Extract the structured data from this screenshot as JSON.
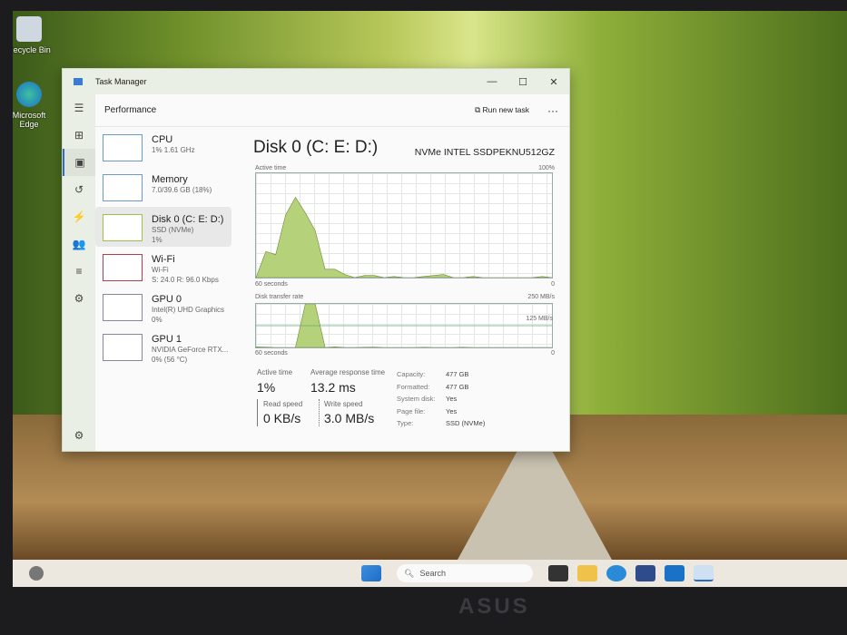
{
  "desktop": {
    "icons": [
      {
        "label": "Recycle Bin"
      },
      {
        "label": "Microsoft Edge"
      }
    ]
  },
  "window": {
    "title": "Task Manager",
    "minimize": "—",
    "maximize": "☐",
    "close": "✕"
  },
  "header": {
    "title": "Performance",
    "run_new_task": "Run new task",
    "more": "···"
  },
  "rail": [
    "hamburger-icon",
    "processes-icon",
    "performance-icon",
    "app-history-icon",
    "startup-icon",
    "users-icon",
    "details-icon",
    "services-icon",
    "settings-icon"
  ],
  "list": [
    {
      "name": "CPU",
      "sub1": "1% 1.61 GHz",
      "sub2": ""
    },
    {
      "name": "Memory",
      "sub1": "7.0/39.6 GB (18%)",
      "sub2": ""
    },
    {
      "name": "Disk 0 (C: E: D:)",
      "sub1": "SSD (NVMe)",
      "sub2": "1%"
    },
    {
      "name": "Wi-Fi",
      "sub1": "Wi-Fi",
      "sub2": "S: 24.0 R: 96.0 Kbps"
    },
    {
      "name": "GPU 0",
      "sub1": "Intel(R) UHD Graphics",
      "sub2": "0%"
    },
    {
      "name": "GPU 1",
      "sub1": "NVIDIA GeForce RTX...",
      "sub2": "0% (56 °C)"
    }
  ],
  "main": {
    "title": "Disk 0 (C: E: D:)",
    "model": "NVMe INTEL SSDPEKNU512GZ",
    "active_label": "Active time",
    "active_max": "100%",
    "seconds": "60 seconds",
    "zero": "0",
    "transfer_label": "Disk transfer rate",
    "transfer_max": "250 MB/s",
    "transfer_mid": "125 MB/s",
    "active_time_series": [
      0,
      25,
      22,
      60,
      77,
      62,
      45,
      8,
      8,
      3,
      0,
      2,
      2,
      0,
      1,
      0,
      0,
      1,
      2,
      3,
      0,
      0,
      1,
      0,
      0,
      0,
      0,
      0,
      0,
      1,
      0
    ],
    "transfer_series": [
      3,
      2,
      0,
      0,
      0,
      250,
      250,
      0,
      3,
      0,
      0,
      1,
      2,
      0,
      0,
      0,
      0,
      1,
      0,
      0,
      0,
      1,
      0,
      0,
      0,
      0,
      0,
      0,
      0,
      0,
      0
    ],
    "stats": {
      "active_time_label": "Active time",
      "active_time": "1%",
      "avg_resp_label": "Average response time",
      "avg_resp": "13.2 ms",
      "read_label": "Read speed",
      "read": "0 KB/s",
      "write_label": "Write speed",
      "write": "3.0 MB/s"
    },
    "props": [
      {
        "k": "Capacity:",
        "v": "477 GB"
      },
      {
        "k": "Formatted:",
        "v": "477 GB"
      },
      {
        "k": "System disk:",
        "v": "Yes"
      },
      {
        "k": "Page file:",
        "v": "Yes"
      },
      {
        "k": "Type:",
        "v": "SSD (NVMe)"
      }
    ]
  },
  "taskbar": {
    "search": "Search"
  },
  "bezel": {
    "logo": "ASUS"
  }
}
